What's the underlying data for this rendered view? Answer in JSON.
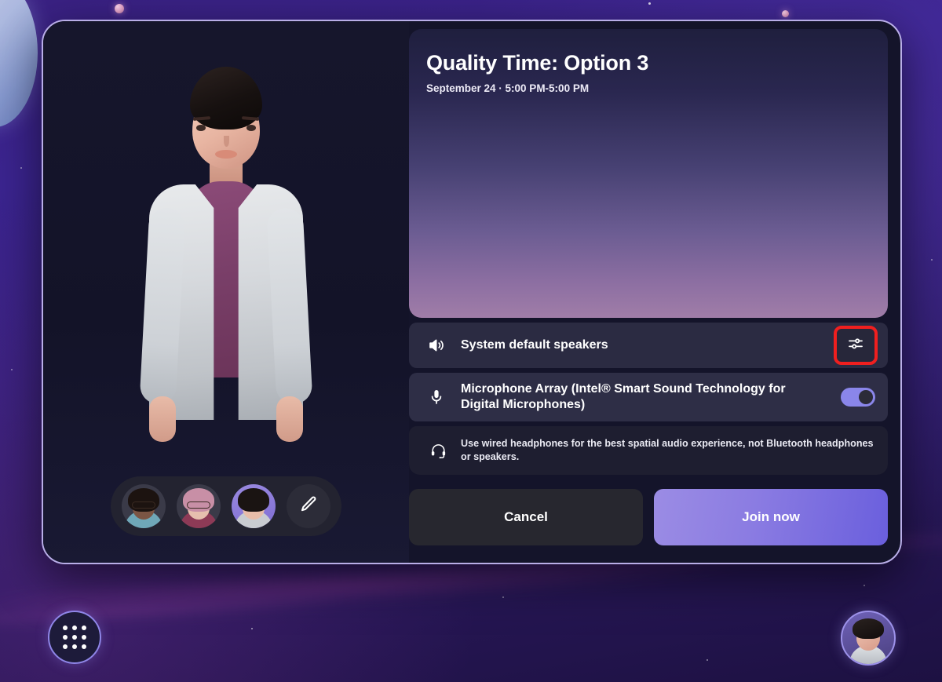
{
  "background": {
    "name": "purple-space-nebula",
    "accent": "#8f86e8",
    "deep": "#241550"
  },
  "modal": {
    "border_color": "#b9aee8",
    "background": "#14142a"
  },
  "meeting": {
    "title": "Quality Time: Option 3",
    "subtitle": "September 24 · 5:00 PM-5:00 PM"
  },
  "preview": {
    "label": "avatar-preview",
    "gradient_top": "#1f1f3e",
    "gradient_bottom": "#a07da8"
  },
  "audio": {
    "speaker": {
      "icon": "speaker-icon",
      "label": "System default speakers",
      "settings_icon": "sliders-icon",
      "settings_highlight_color": "#f01f1f"
    },
    "microphone": {
      "icon": "microphone-icon",
      "label": "Microphone Array (Intel® Smart Sound Technology for Digital Microphones)",
      "toggle_state": "on",
      "toggle_color": "#8a86ea"
    },
    "hint": {
      "icon": "headset-icon",
      "text": "Use wired headphones for the best spatial audio experience, not Bluetooth headphones or speakers."
    }
  },
  "actions": {
    "cancel_label": "Cancel",
    "join_label": "Join now",
    "join_gradient_from": "#9b8ce4",
    "join_gradient_to": "#6a5fdd"
  },
  "avatar_picker": {
    "items": [
      {
        "name": "avatar-thumb-1",
        "selected": false,
        "hair": "#1c1310",
        "skin": "#7b5544",
        "body": "#6fa7b8"
      },
      {
        "name": "avatar-thumb-2",
        "selected": false,
        "hair": "#c88fa6",
        "skin": "#e6bfae",
        "body": "#8d3a56"
      },
      {
        "name": "avatar-thumb-3",
        "selected": true,
        "hair": "#1a1412",
        "skin": "#e8bda9",
        "body": "#c9ccd1"
      }
    ],
    "edit_icon": "pencil-icon"
  },
  "chrome": {
    "launcher_icon": "app-grid-icon",
    "profile_icon": "profile-avatar"
  }
}
